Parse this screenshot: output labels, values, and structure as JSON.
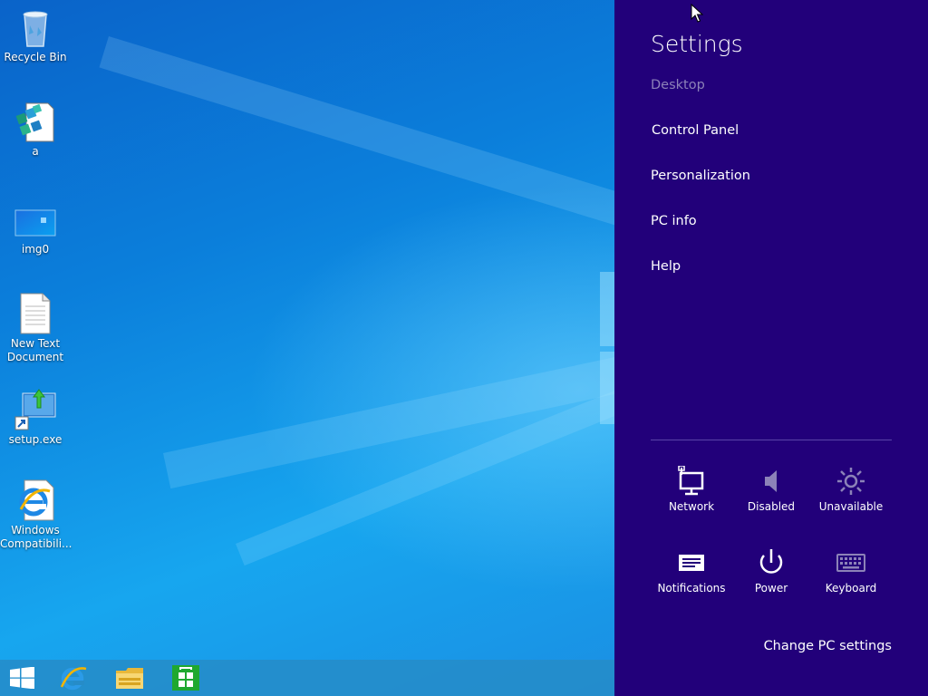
{
  "desktop": {
    "icons": [
      {
        "label": "Recycle Bin",
        "icon": "recycle-bin-icon"
      },
      {
        "label": "a",
        "icon": "registry-file-icon"
      },
      {
        "label": "img0",
        "icon": "image-file-icon"
      },
      {
        "label": "New Text Document",
        "icon": "text-document-icon"
      },
      {
        "label": "setup.exe",
        "icon": "setup-shortcut-icon"
      },
      {
        "label": "Windows Compatibili...",
        "icon": "internet-explorer-icon"
      }
    ]
  },
  "taskbar": {
    "buttons": [
      {
        "name": "start",
        "icon": "windows-logo-icon"
      },
      {
        "name": "internet-explorer",
        "icon": "internet-explorer-icon"
      },
      {
        "name": "file-explorer",
        "icon": "folder-icon"
      },
      {
        "name": "store",
        "icon": "store-icon"
      }
    ]
  },
  "settings": {
    "title": "Settings",
    "menu": [
      {
        "label": "Desktop",
        "dim": true
      },
      {
        "label": "Control Panel"
      },
      {
        "label": "Personalization"
      },
      {
        "label": "PC info"
      },
      {
        "label": "Help"
      }
    ],
    "quick": [
      {
        "label": "Network",
        "icon": "network-icon"
      },
      {
        "label": "Disabled",
        "icon": "speaker-icon"
      },
      {
        "label": "Unavailable",
        "icon": "brightness-icon"
      },
      {
        "label": "Notifications",
        "icon": "notifications-icon"
      },
      {
        "label": "Power",
        "icon": "power-icon"
      },
      {
        "label": "Keyboard",
        "icon": "keyboard-icon"
      }
    ],
    "change_pc_settings": "Change PC settings"
  },
  "colors": {
    "charms_bg": "#22007a",
    "desktop_blue": "#0b7fdb",
    "taskbar": "#268cc8"
  }
}
